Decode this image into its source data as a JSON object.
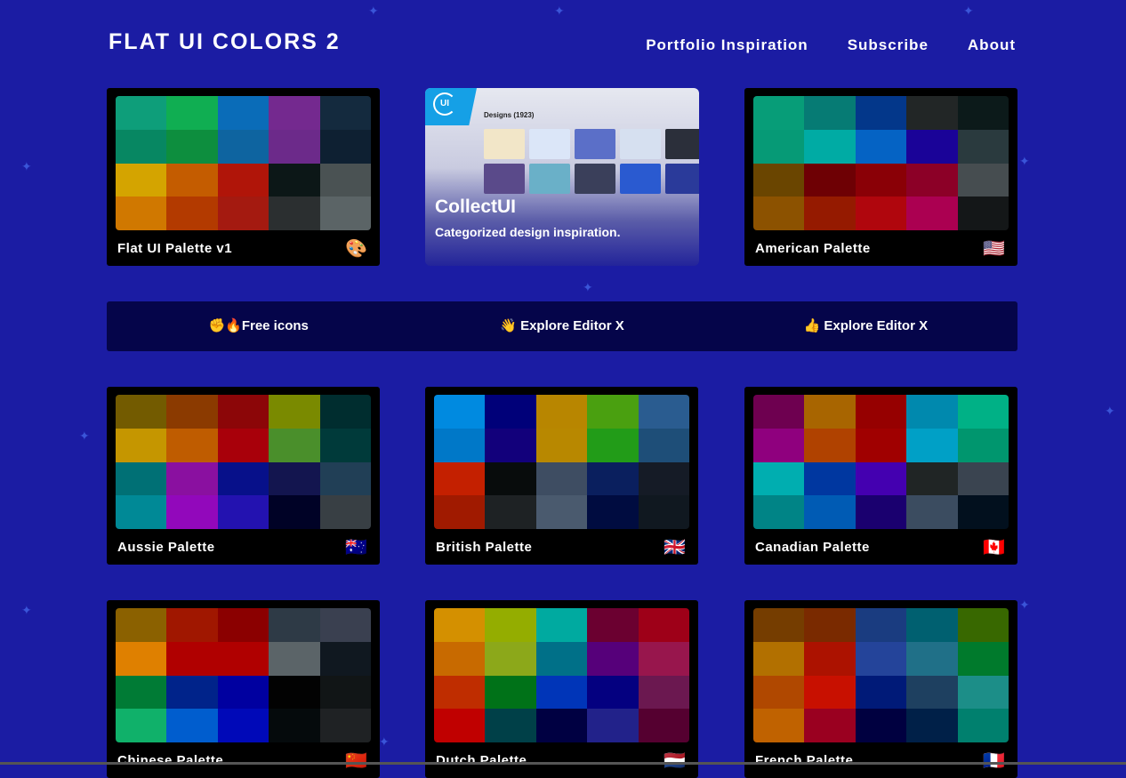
{
  "header": {
    "logo": "FLAT UI COLORS 2",
    "nav": [
      "Portfolio Inspiration",
      "Subscribe",
      "About"
    ]
  },
  "ad": {
    "title": "CollectUI",
    "subtitle": "Categorized design inspiration.",
    "screenshot_heading": "Designs (1923)",
    "logo_text": "UI"
  },
  "banner": [
    {
      "icon": "✊🔥",
      "label": "Free icons"
    },
    {
      "icon": "👋",
      "label": "Explore Editor X"
    },
    {
      "icon": "👍",
      "label": "Explore Editor X"
    }
  ],
  "palettes": [
    {
      "name": "Flat UI Palette v1",
      "flag": "🎨",
      "colors": [
        "#0e9e7a",
        "#10ae52",
        "#0a6cb8",
        "#74298f",
        "#142a3e",
        "#078762",
        "#0d8e3e",
        "#0e64a0",
        "#6c2a8a",
        "#0e2032",
        "#d4a400",
        "#c45c00",
        "#b01509",
        "#0c1717",
        "#4a5253",
        "#d07800",
        "#b33a00",
        "#a41a10",
        "#2b2f30",
        "#5b6466"
      ]
    },
    {
      "name": "American Palette",
      "flag": "🇺🇸",
      "colors": [
        "#079d78",
        "#067b74",
        "#03378a",
        "#222626",
        "#0c1a1a",
        "#069a76",
        "#00aba4",
        "#0563c4",
        "#1a0398",
        "#2a3a3e",
        "#6a4500",
        "#6e0004",
        "#8a0006",
        "#8c0027",
        "#464d50",
        "#8c5200",
        "#951a00",
        "#b0060d",
        "#ab0051",
        "#141718"
      ]
    },
    {
      "name": "Aussie Palette",
      "flag": "🇦🇺",
      "colors": [
        "#735b00",
        "#8b3a00",
        "#8c0608",
        "#7a8a00",
        "#002d2f",
        "#c59600",
        "#bf5c00",
        "#a8000a",
        "#4a8f2b",
        "#003a3a",
        "#007075",
        "#8a10a0",
        "#07108a",
        "#13154f",
        "#213f56",
        "#008996",
        "#9208bb",
        "#2312b0",
        "#000226",
        "#383f44"
      ]
    },
    {
      "name": "British Palette",
      "flag": "🇬🇧",
      "colors": [
        "#008ae0",
        "#000079",
        "#b88600",
        "#4aa010",
        "#2a5c90",
        "#0078c8",
        "#12007b",
        "#b88800",
        "#229c18",
        "#1e4e78",
        "#c42000",
        "#080c0c",
        "#3e4d62",
        "#0a1f5e",
        "#151b26",
        "#a01a00",
        "#1e2224",
        "#4a5a6e",
        "#000c40",
        "#101820"
      ]
    },
    {
      "name": "Canadian Palette",
      "flag": "🇨🇦",
      "colors": [
        "#6e0050",
        "#a86500",
        "#960000",
        "#0089ae",
        "#00b186",
        "#8f007e",
        "#b04200",
        "#a00000",
        "#00a0c6",
        "#00966e",
        "#00aeb0",
        "#0037a0",
        "#4400b0",
        "#202525",
        "#3a4450",
        "#008486",
        "#005bb4",
        "#1a006f",
        "#3b4c60",
        "#02101e"
      ]
    },
    {
      "name": "Chinese Palette",
      "flag": "🇨🇳",
      "colors": [
        "#8b6100",
        "#a01700",
        "#8b0000",
        "#2e3a46",
        "#3a4050",
        "#df8000",
        "#b00000",
        "#b00000",
        "#5b6468",
        "#101820",
        "#007b35",
        "#00238a",
        "#0000a0",
        "#020202",
        "#111516",
        "#10b16a",
        "#005dce",
        "#0009b8",
        "#050a0c",
        "#1f2224"
      ]
    },
    {
      "name": "Dutch Palette",
      "flag": "🇳🇱",
      "colors": [
        "#d49000",
        "#94ad00",
        "#00aaa0",
        "#6b0030",
        "#9e0018",
        "#c86a00",
        "#8ca81a",
        "#007088",
        "#56007a",
        "#98164d",
        "#bf2d00",
        "#007218",
        "#0035b8",
        "#040080",
        "#6b1850",
        "#c00000",
        "#004048",
        "#000042",
        "#22228a",
        "#550030"
      ]
    },
    {
      "name": "French Palette",
      "flag": "🇫🇷",
      "colors": [
        "#753d00",
        "#7a2a00",
        "#1a3c80",
        "#006070",
        "#386800",
        "#b27000",
        "#ac1200",
        "#24449a",
        "#207088",
        "#007a2c",
        "#b04800",
        "#c81000",
        "#001a78",
        "#1e4060",
        "#1c8e88",
        "#c06200",
        "#9a0020",
        "#000040",
        "#002048",
        "#00806e"
      ]
    }
  ]
}
